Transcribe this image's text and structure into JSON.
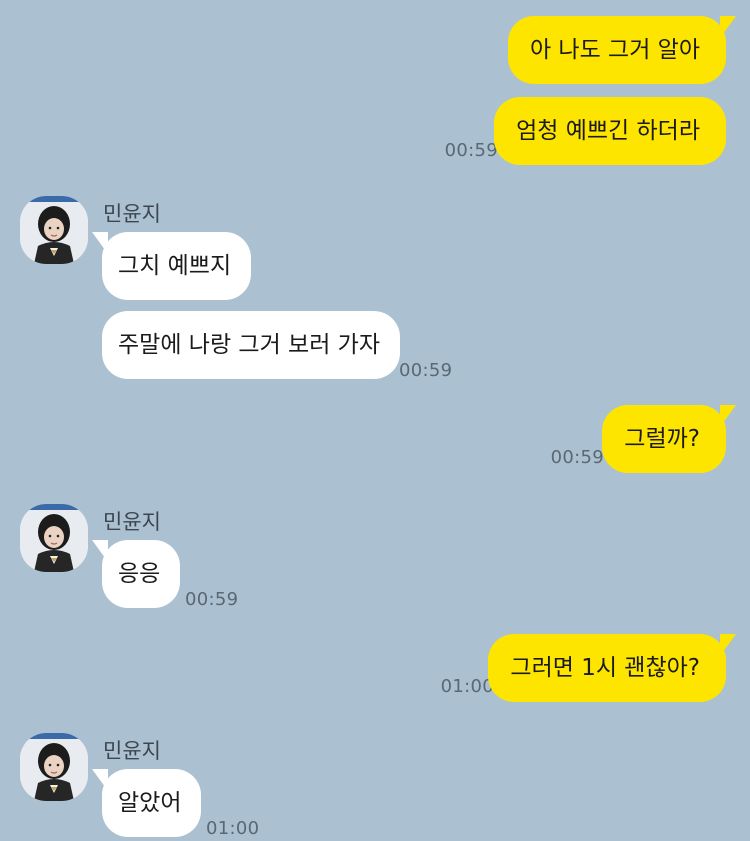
{
  "contact": {
    "name": "민윤지"
  },
  "messages": [
    {
      "from": "me",
      "text": "아 나도 그거 알아"
    },
    {
      "from": "me",
      "text": "엄청 예쁘긴 하더라",
      "time": "00:59"
    },
    {
      "from": "them",
      "text": "그치 예쁘지"
    },
    {
      "from": "them",
      "text": "주말에 나랑 그거 보러 가자",
      "time": "00:59"
    },
    {
      "from": "me",
      "text": "그럴까?",
      "time": "00:59"
    },
    {
      "from": "them",
      "text": "응응",
      "time": "00:59"
    },
    {
      "from": "me",
      "text": "그러면 1시 괜찮아?",
      "time": "01:00"
    },
    {
      "from": "them",
      "text": "알았어",
      "time": "01:00"
    }
  ],
  "colors": {
    "background": "#abc1d1",
    "my_bubble": "#fee500",
    "their_bubble": "#ffffff",
    "timestamp": "#5a6874"
  },
  "icons": {
    "avatar": "profile-photo-avatar"
  }
}
